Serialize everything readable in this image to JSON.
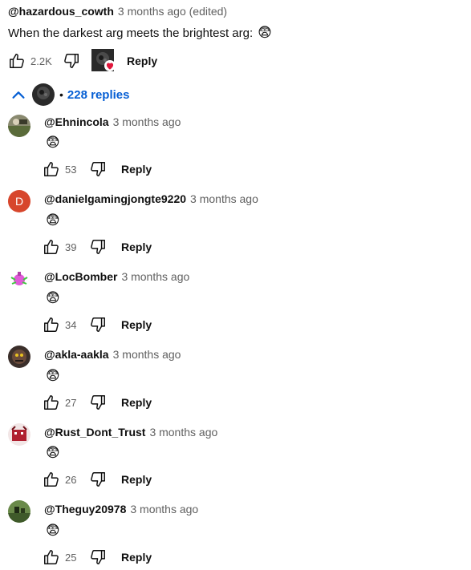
{
  "colors": {
    "link": "#065fd4",
    "muted": "#606060",
    "heart": "#e0173c",
    "avatar_d": "#d7462c"
  },
  "parent": {
    "handle": "@hazardous_cowth",
    "time": "3 months ago (edited)",
    "text": "When the darkest arg meets the brightest arg:",
    "emoji": "😨",
    "likes": "2.2K",
    "reply_label": "Reply"
  },
  "replies_toggle": {
    "bullet": "•",
    "label": "228 replies"
  },
  "replies": [
    {
      "handle": "@Ehnincola",
      "time": "3 months ago",
      "text": "😨",
      "likes": "53",
      "reply_label": "Reply"
    },
    {
      "handle": "@danielgamingjongte9220",
      "time": "3 months ago",
      "text": "😨",
      "likes": "39",
      "reply_label": "Reply",
      "avatar_letter": "D"
    },
    {
      "handle": "@LocBomber",
      "time": "3 months ago",
      "text": "😨",
      "likes": "34",
      "reply_label": "Reply"
    },
    {
      "handle": "@akla-aakla",
      "time": "3 months ago",
      "text": "😨",
      "likes": "27",
      "reply_label": "Reply"
    },
    {
      "handle": "@Rust_Dont_Trust",
      "time": "3 months ago",
      "text": "😨",
      "likes": "26",
      "reply_label": "Reply"
    },
    {
      "handle": "@Theguy20978",
      "time": "3 months ago",
      "text": "😨",
      "likes": "25",
      "reply_label": "Reply"
    }
  ]
}
